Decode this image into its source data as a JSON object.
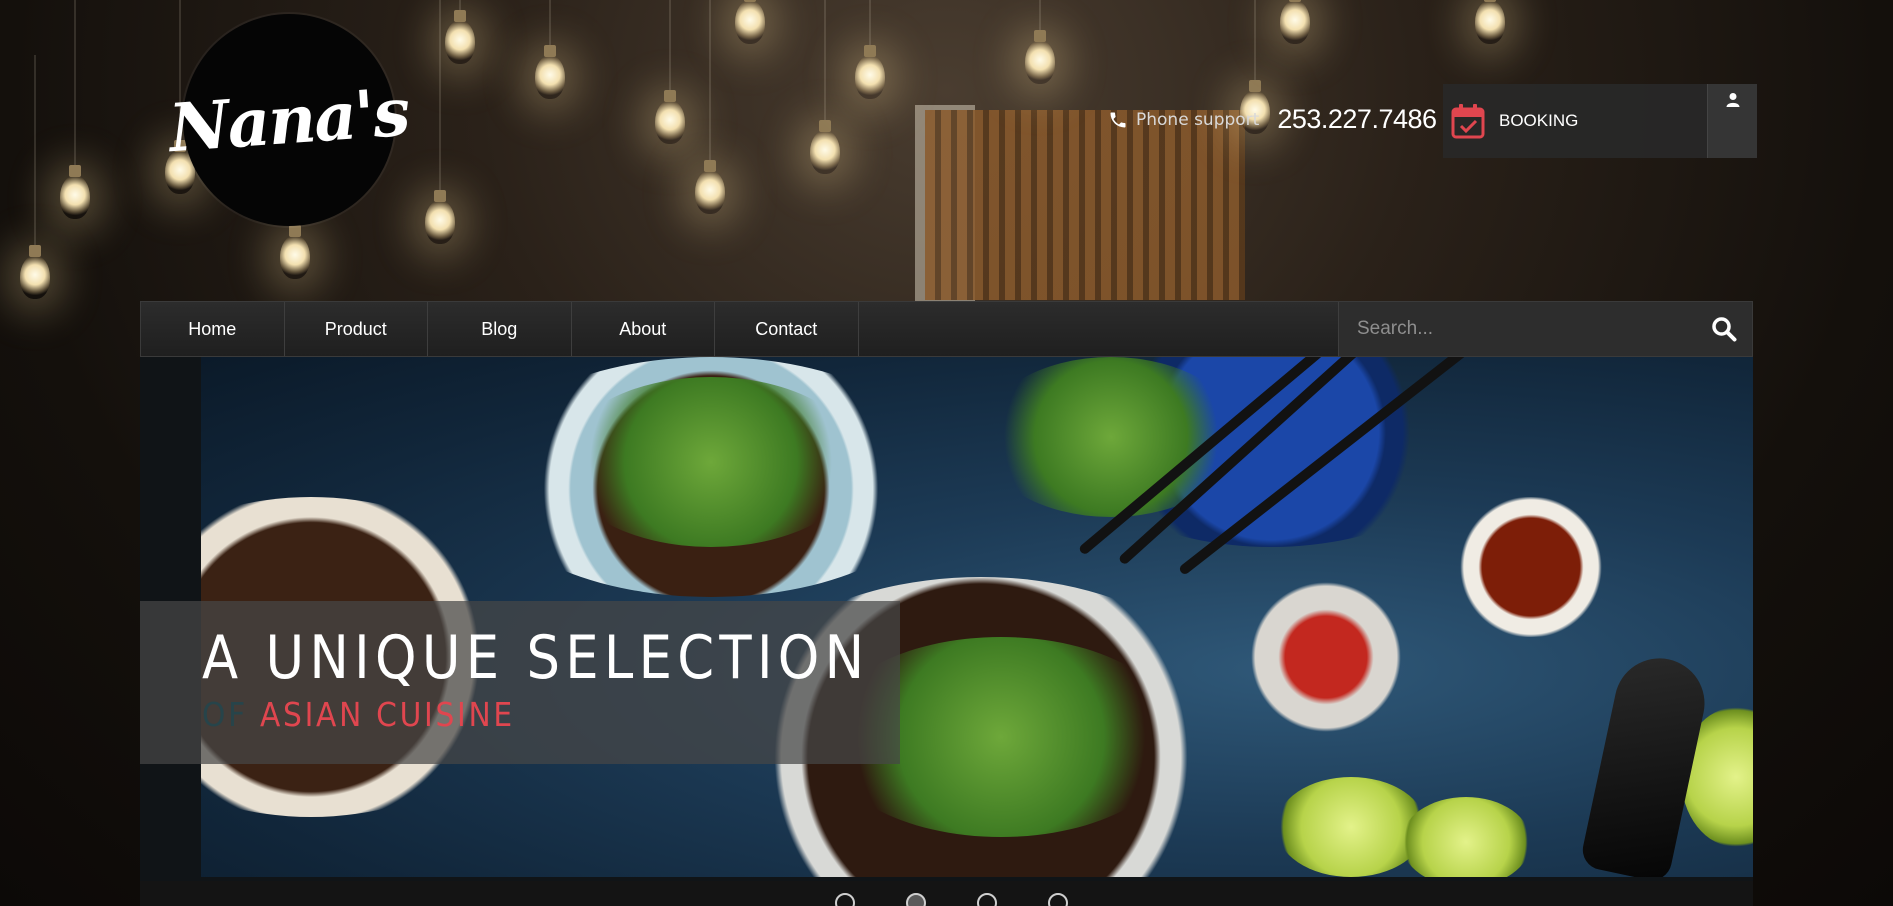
{
  "logo": {
    "text": "Nana's"
  },
  "header": {
    "phone_label": "Phone support",
    "phone_number": "253.227.7486",
    "booking_label": "BOOKING"
  },
  "nav": {
    "items": [
      {
        "label": "Home"
      },
      {
        "label": "Product"
      },
      {
        "label": "Blog"
      },
      {
        "label": "About"
      },
      {
        "label": "Contact"
      }
    ]
  },
  "search": {
    "placeholder": "Search..."
  },
  "slider": {
    "title": "A UNIQUE SELECTION",
    "subtitle_prefix": "OF",
    "subtitle_accent": "ASIAN CUISINE",
    "slides_count": 4,
    "active_slide": 2
  },
  "colors": {
    "accent": "#e0464f",
    "booking_icon": "#e0464f",
    "nav_bg": "#262626"
  },
  "icons": [
    "phone-icon",
    "calendar-check-icon",
    "user-icon",
    "search-icon"
  ]
}
